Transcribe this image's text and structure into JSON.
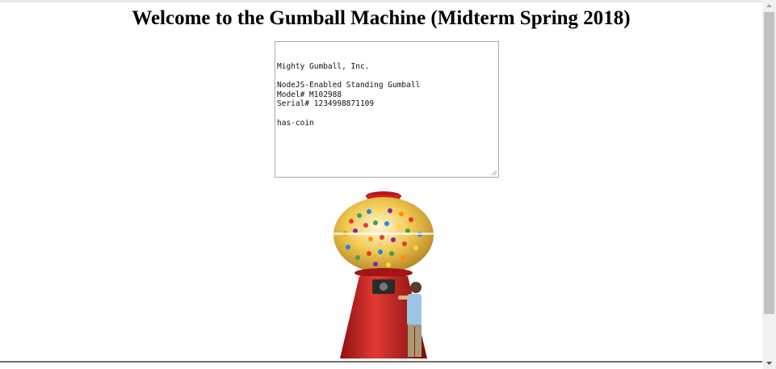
{
  "page": {
    "title": "Welcome to the Gumball Machine (Midterm Spring 2018)"
  },
  "status_box": {
    "text": "Mighty Gumball, Inc.\n\nNodeJS-Enabled Standing Gumball\nModel# M102988\nSerial# 1234998871109\n\nhas-coin"
  },
  "image": {
    "subject": "gumball-machine-with-child",
    "machine_color": "#c81e1e",
    "globe_color": "#f2c64d"
  },
  "colors": {
    "scrollbar_track": "#f1f1f1",
    "scrollbar_thumb": "#c1c1c1"
  }
}
